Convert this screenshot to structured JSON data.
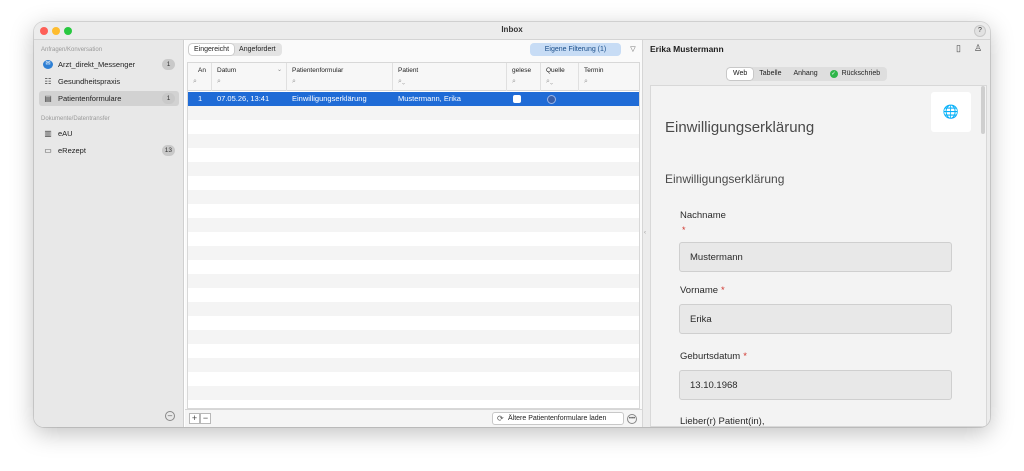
{
  "window": {
    "title": "Inbox",
    "help": "?"
  },
  "sidebar": {
    "section1": "Anfragen/Konversation",
    "section2": "Dokumente/Datentransfer",
    "items": [
      {
        "label": "Arzt_direkt_Messenger",
        "badge": "1",
        "icon": "messenger-icon"
      },
      {
        "label": "Gesundheitspraxis",
        "badge": "",
        "icon": "people-icon"
      },
      {
        "label": "Patientenformulare",
        "badge": "1",
        "icon": "form-icon",
        "active": true
      },
      {
        "label": "eAU",
        "badge": "",
        "icon": "document-icon"
      },
      {
        "label": "eRezept",
        "badge": "13",
        "icon": "prescription-icon"
      }
    ]
  },
  "list": {
    "tabs": [
      "Eingereicht",
      "Angefordert"
    ],
    "active_tab": "Eingereicht",
    "filter_label": "Eigene Filterung (1)",
    "columns": [
      "An",
      "Datum",
      "Patientenformular",
      "Patient",
      "gelese",
      "Quelle",
      "Termin"
    ],
    "rows": [
      {
        "an": "1",
        "datum": "07.05.26, 13:41",
        "formular": "Einwilligungserklärung",
        "patient": "Mustermann, Erika",
        "gelesen": false,
        "selected": true
      }
    ],
    "add": "+",
    "remove": "−",
    "load_older": "Ältere Patientenformulare laden"
  },
  "detail": {
    "name": "Erika Mustermann",
    "tabs": [
      "Web",
      "Tabelle",
      "Anhang",
      "Rückschrieb"
    ],
    "active_tab": "Web",
    "form": {
      "title": "Einwilligungserklärung",
      "subtitle": "Einwilligungserklärung",
      "fields": [
        {
          "label": "Nachname",
          "value": "Mustermann",
          "required": true
        },
        {
          "label": "Vorname",
          "value": "Erika",
          "required": true
        },
        {
          "label": "Geburtsdatum",
          "value": "13.10.1968",
          "required": true
        }
      ],
      "footer_text": "Lieber(r) Patient(in),"
    }
  },
  "colors": {
    "selection": "#1f6bd6",
    "filter_bg": "#c7dcf5",
    "required": "#d0342c",
    "ok": "#2fb54a"
  }
}
